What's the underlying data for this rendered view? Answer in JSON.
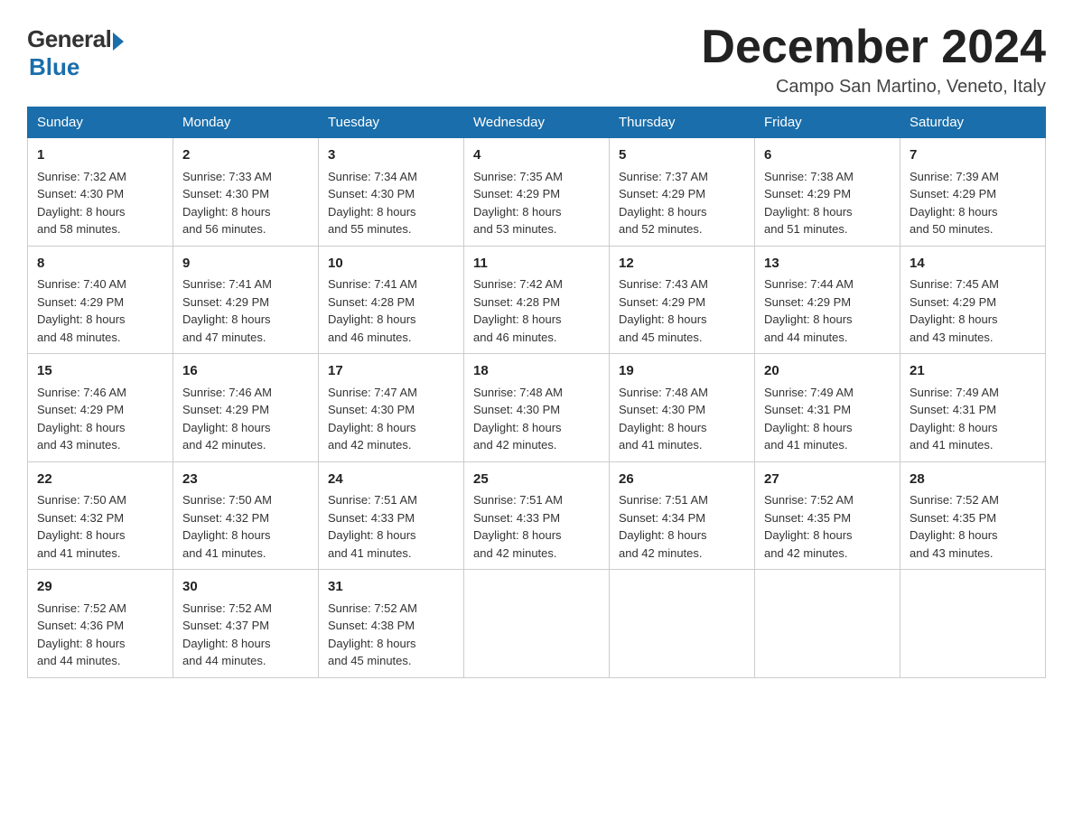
{
  "logo": {
    "general": "General",
    "blue": "Blue"
  },
  "title": "December 2024",
  "location": "Campo San Martino, Veneto, Italy",
  "weekdays": [
    "Sunday",
    "Monday",
    "Tuesday",
    "Wednesday",
    "Thursday",
    "Friday",
    "Saturday"
  ],
  "weeks": [
    [
      {
        "day": "1",
        "sunrise": "7:32 AM",
        "sunset": "4:30 PM",
        "daylight": "8 hours and 58 minutes."
      },
      {
        "day": "2",
        "sunrise": "7:33 AM",
        "sunset": "4:30 PM",
        "daylight": "8 hours and 56 minutes."
      },
      {
        "day": "3",
        "sunrise": "7:34 AM",
        "sunset": "4:30 PM",
        "daylight": "8 hours and 55 minutes."
      },
      {
        "day": "4",
        "sunrise": "7:35 AM",
        "sunset": "4:29 PM",
        "daylight": "8 hours and 53 minutes."
      },
      {
        "day": "5",
        "sunrise": "7:37 AM",
        "sunset": "4:29 PM",
        "daylight": "8 hours and 52 minutes."
      },
      {
        "day": "6",
        "sunrise": "7:38 AM",
        "sunset": "4:29 PM",
        "daylight": "8 hours and 51 minutes."
      },
      {
        "day": "7",
        "sunrise": "7:39 AM",
        "sunset": "4:29 PM",
        "daylight": "8 hours and 50 minutes."
      }
    ],
    [
      {
        "day": "8",
        "sunrise": "7:40 AM",
        "sunset": "4:29 PM",
        "daylight": "8 hours and 48 minutes."
      },
      {
        "day": "9",
        "sunrise": "7:41 AM",
        "sunset": "4:29 PM",
        "daylight": "8 hours and 47 minutes."
      },
      {
        "day": "10",
        "sunrise": "7:41 AM",
        "sunset": "4:28 PM",
        "daylight": "8 hours and 46 minutes."
      },
      {
        "day": "11",
        "sunrise": "7:42 AM",
        "sunset": "4:28 PM",
        "daylight": "8 hours and 46 minutes."
      },
      {
        "day": "12",
        "sunrise": "7:43 AM",
        "sunset": "4:29 PM",
        "daylight": "8 hours and 45 minutes."
      },
      {
        "day": "13",
        "sunrise": "7:44 AM",
        "sunset": "4:29 PM",
        "daylight": "8 hours and 44 minutes."
      },
      {
        "day": "14",
        "sunrise": "7:45 AM",
        "sunset": "4:29 PM",
        "daylight": "8 hours and 43 minutes."
      }
    ],
    [
      {
        "day": "15",
        "sunrise": "7:46 AM",
        "sunset": "4:29 PM",
        "daylight": "8 hours and 43 minutes."
      },
      {
        "day": "16",
        "sunrise": "7:46 AM",
        "sunset": "4:29 PM",
        "daylight": "8 hours and 42 minutes."
      },
      {
        "day": "17",
        "sunrise": "7:47 AM",
        "sunset": "4:30 PM",
        "daylight": "8 hours and 42 minutes."
      },
      {
        "day": "18",
        "sunrise": "7:48 AM",
        "sunset": "4:30 PM",
        "daylight": "8 hours and 42 minutes."
      },
      {
        "day": "19",
        "sunrise": "7:48 AM",
        "sunset": "4:30 PM",
        "daylight": "8 hours and 41 minutes."
      },
      {
        "day": "20",
        "sunrise": "7:49 AM",
        "sunset": "4:31 PM",
        "daylight": "8 hours and 41 minutes."
      },
      {
        "day": "21",
        "sunrise": "7:49 AM",
        "sunset": "4:31 PM",
        "daylight": "8 hours and 41 minutes."
      }
    ],
    [
      {
        "day": "22",
        "sunrise": "7:50 AM",
        "sunset": "4:32 PM",
        "daylight": "8 hours and 41 minutes."
      },
      {
        "day": "23",
        "sunrise": "7:50 AM",
        "sunset": "4:32 PM",
        "daylight": "8 hours and 41 minutes."
      },
      {
        "day": "24",
        "sunrise": "7:51 AM",
        "sunset": "4:33 PM",
        "daylight": "8 hours and 41 minutes."
      },
      {
        "day": "25",
        "sunrise": "7:51 AM",
        "sunset": "4:33 PM",
        "daylight": "8 hours and 42 minutes."
      },
      {
        "day": "26",
        "sunrise": "7:51 AM",
        "sunset": "4:34 PM",
        "daylight": "8 hours and 42 minutes."
      },
      {
        "day": "27",
        "sunrise": "7:52 AM",
        "sunset": "4:35 PM",
        "daylight": "8 hours and 42 minutes."
      },
      {
        "day": "28",
        "sunrise": "7:52 AM",
        "sunset": "4:35 PM",
        "daylight": "8 hours and 43 minutes."
      }
    ],
    [
      {
        "day": "29",
        "sunrise": "7:52 AM",
        "sunset": "4:36 PM",
        "daylight": "8 hours and 44 minutes."
      },
      {
        "day": "30",
        "sunrise": "7:52 AM",
        "sunset": "4:37 PM",
        "daylight": "8 hours and 44 minutes."
      },
      {
        "day": "31",
        "sunrise": "7:52 AM",
        "sunset": "4:38 PM",
        "daylight": "8 hours and 45 minutes."
      },
      null,
      null,
      null,
      null
    ]
  ]
}
